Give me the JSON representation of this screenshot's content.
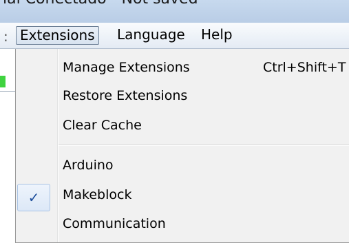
{
  "window": {
    "title": "ial Conectado - Not saved"
  },
  "menu_bar": {
    "separator_glyph": ":",
    "items": [
      {
        "label": "Extensions"
      },
      {
        "label": "Language"
      },
      {
        "label": "Help"
      }
    ]
  },
  "extensions_menu": {
    "items": [
      {
        "label": "Manage Extensions",
        "shortcut": "Ctrl+Shift+T"
      },
      {
        "label": "Restore Extensions"
      },
      {
        "label": "Clear Cache"
      },
      {
        "label": "Arduino",
        "checked": false
      },
      {
        "label": "Makeblock",
        "checked": true
      },
      {
        "label": "Communication",
        "checked": false
      }
    ],
    "check_glyph": "✓"
  },
  "colors": {
    "title_bar": "#c7d9ee",
    "menu_bg": "#f1f1f1",
    "check_color": "#1f4f9c",
    "status_green": "#3fd33f"
  }
}
